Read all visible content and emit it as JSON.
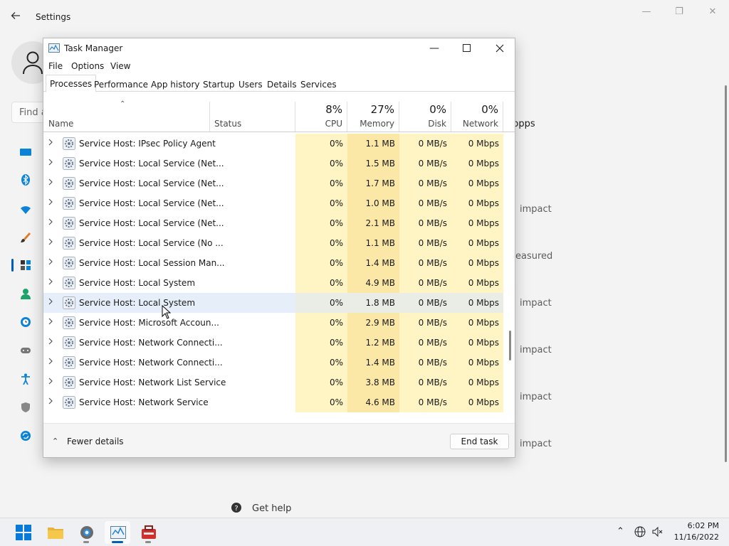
{
  "settings": {
    "title": "Settings",
    "search_placeholder": "Find a setting",
    "right_texts": [
      "Popps",
      "impact",
      "easured",
      "impact",
      "impact",
      "impact",
      "impact"
    ],
    "get_help": "Get help"
  },
  "task_manager": {
    "title": "Task Manager",
    "menu": [
      "File",
      "Options",
      "View"
    ],
    "tabs": [
      "Processes",
      "Performance",
      "App history",
      "Startup",
      "Users",
      "Details",
      "Services"
    ],
    "active_tab": "Processes",
    "columns": {
      "name": "Name",
      "status": "Status",
      "cpu": {
        "pct": "8%",
        "label": "CPU"
      },
      "memory": {
        "pct": "27%",
        "label": "Memory"
      },
      "disk": {
        "pct": "0%",
        "label": "Disk"
      },
      "network": {
        "pct": "0%",
        "label": "Network"
      }
    },
    "processes": [
      {
        "name": "Service Host: IPsec Policy Agent",
        "cpu": "0%",
        "memory": "1.1 MB",
        "disk": "0 MB/s",
        "network": "0 Mbps"
      },
      {
        "name": "Service Host: Local Service (Net...",
        "cpu": "0%",
        "memory": "1.5 MB",
        "disk": "0 MB/s",
        "network": "0 Mbps"
      },
      {
        "name": "Service Host: Local Service (Net...",
        "cpu": "0%",
        "memory": "1.7 MB",
        "disk": "0 MB/s",
        "network": "0 Mbps"
      },
      {
        "name": "Service Host: Local Service (Net...",
        "cpu": "0%",
        "memory": "1.0 MB",
        "disk": "0 MB/s",
        "network": "0 Mbps"
      },
      {
        "name": "Service Host: Local Service (Net...",
        "cpu": "0%",
        "memory": "2.1 MB",
        "disk": "0 MB/s",
        "network": "0 Mbps"
      },
      {
        "name": "Service Host: Local Service (No ...",
        "cpu": "0%",
        "memory": "1.1 MB",
        "disk": "0 MB/s",
        "network": "0 Mbps"
      },
      {
        "name": "Service Host: Local Session Man...",
        "cpu": "0%",
        "memory": "1.4 MB",
        "disk": "0 MB/s",
        "network": "0 Mbps"
      },
      {
        "name": "Service Host: Local System",
        "cpu": "0%",
        "memory": "4.9 MB",
        "disk": "0 MB/s",
        "network": "0 Mbps"
      },
      {
        "name": "Service Host: Local System",
        "cpu": "0%",
        "memory": "1.8 MB",
        "disk": "0 MB/s",
        "network": "0 Mbps"
      },
      {
        "name": "Service Host: Microsoft Accoun...",
        "cpu": "0%",
        "memory": "2.9 MB",
        "disk": "0 MB/s",
        "network": "0 Mbps"
      },
      {
        "name": "Service Host: Network Connecti...",
        "cpu": "0%",
        "memory": "1.2 MB",
        "disk": "0 MB/s",
        "network": "0 Mbps"
      },
      {
        "name": "Service Host: Network Connecti...",
        "cpu": "0%",
        "memory": "1.4 MB",
        "disk": "0 MB/s",
        "network": "0 Mbps"
      },
      {
        "name": "Service Host: Network List Service",
        "cpu": "0%",
        "memory": "3.8 MB",
        "disk": "0 MB/s",
        "network": "0 Mbps"
      },
      {
        "name": "Service Host: Network Service",
        "cpu": "0%",
        "memory": "4.6 MB",
        "disk": "0 MB/s",
        "network": "0 Mbps"
      }
    ],
    "hovered_row": 8,
    "fewer_details": "Fewer details",
    "end_task": "End task"
  },
  "taskbar": {
    "apps": [
      "start-icon",
      "file-explorer-icon",
      "settings-icon",
      "task-manager-icon",
      "toolbox-icon"
    ],
    "time": "6:02 PM",
    "date": "11/16/2022"
  },
  "colors": {
    "cpu_fill": "#fff4c4",
    "memory_fill": "#fbe8a6",
    "accent": "#005fb8",
    "hover_row": "#e6eff9"
  }
}
